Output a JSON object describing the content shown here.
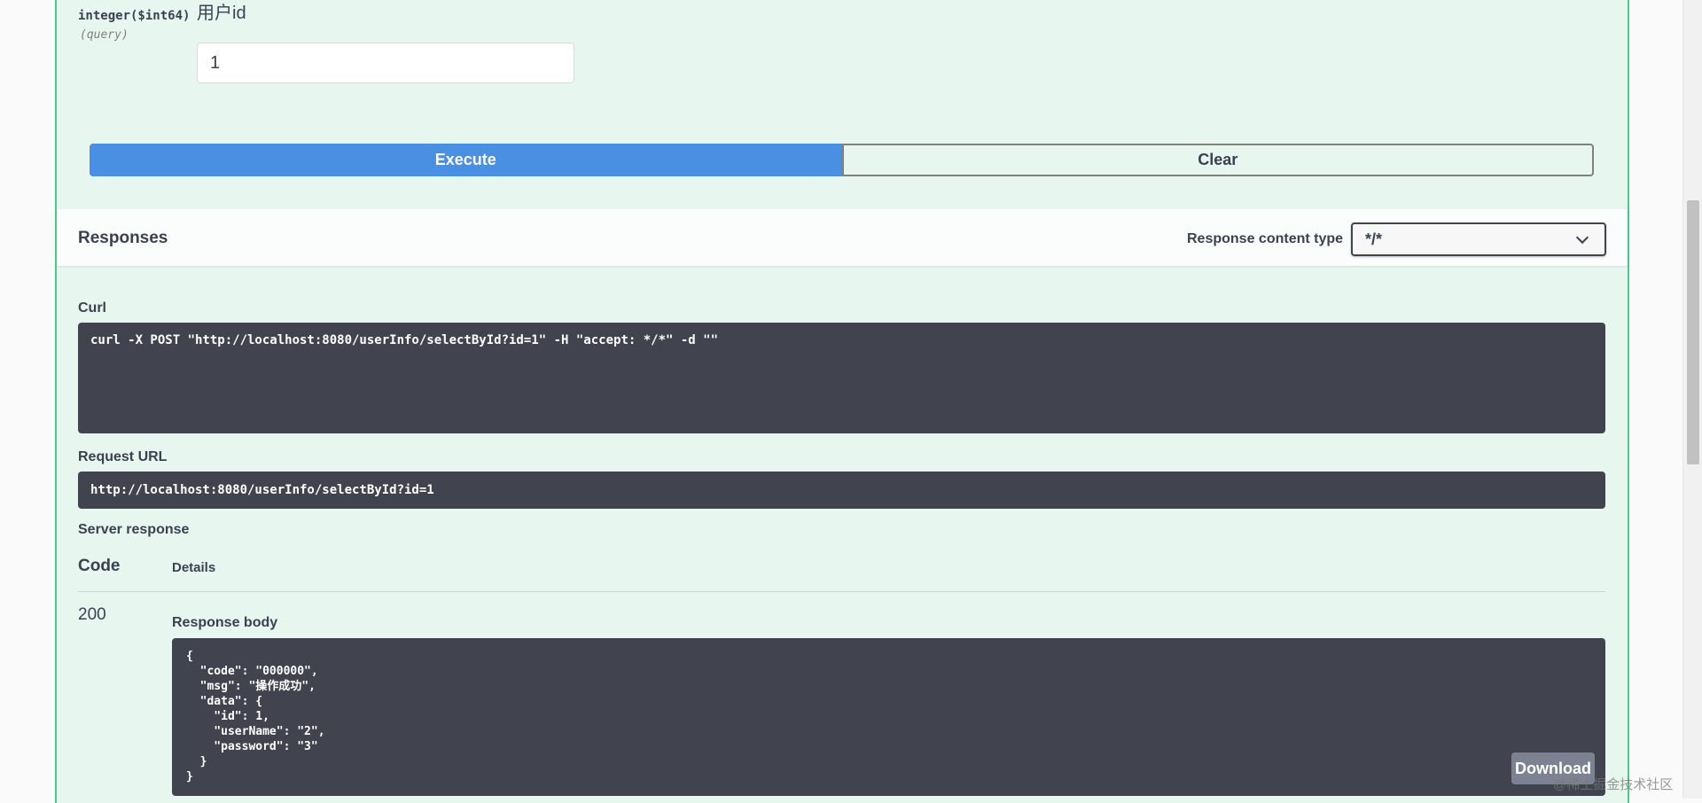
{
  "parameter": {
    "type": "integer($int64)",
    "location": "(query)",
    "description": "用户id",
    "value": "1"
  },
  "buttons": {
    "execute": "Execute",
    "clear": "Clear"
  },
  "responses": {
    "title": "Responses",
    "content_type_label": "Response content type",
    "content_type_value": "*/*"
  },
  "curl": {
    "label": "Curl",
    "command": "curl -X POST \"http://localhost:8080/userInfo/selectById?id=1\" -H \"accept: */*\" -d \"\""
  },
  "request_url": {
    "label": "Request URL",
    "value": "http://localhost:8080/userInfo/selectById?id=1"
  },
  "server_response": {
    "label": "Server response",
    "col_code": "Code",
    "col_details": "Details",
    "status_code": "200",
    "body_label": "Response body",
    "body": "{\n  \"code\": \"000000\",\n  \"msg\": \"操作成功\",\n  \"data\": {\n    \"id\": 1,\n    \"userName\": \"2\",\n    \"password\": \"3\"\n  }\n}",
    "download_label": "Download"
  },
  "watermark": "@稀土掘金技术社区",
  "colors": {
    "get_green": "#49cc90",
    "block_bg": "#e8f6f0",
    "execute_blue": "#4990e2",
    "code_bg": "#41444e"
  }
}
